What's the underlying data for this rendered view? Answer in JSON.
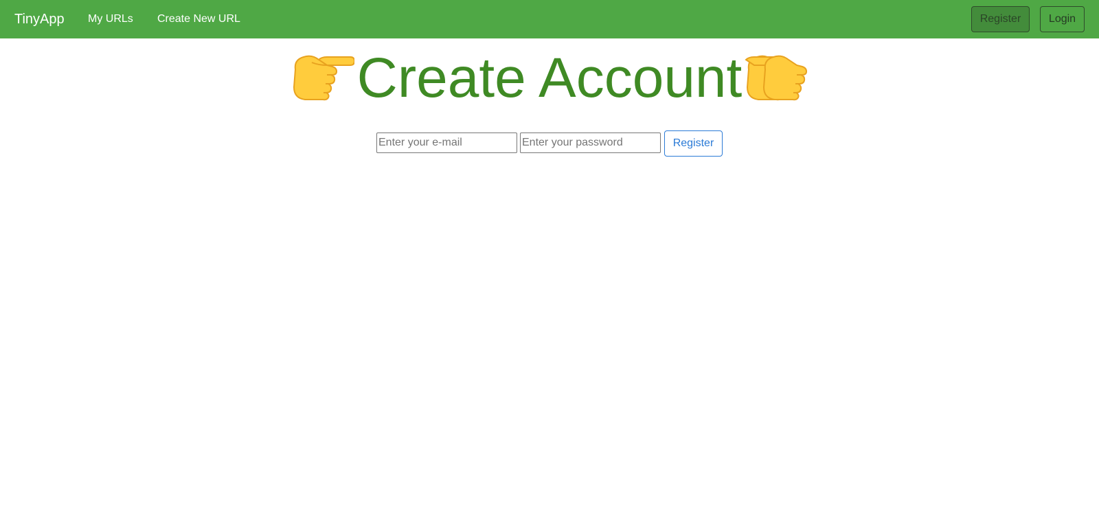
{
  "navbar": {
    "brand": "TinyApp",
    "links": [
      "My URLs",
      "Create New URL"
    ],
    "register_label": "Register",
    "login_label": "Login",
    "background_color": "#4fa845"
  },
  "main": {
    "title": "Create Account",
    "title_color": "#3f8a24",
    "left_icon": "pointing-right-hand-icon",
    "right_icon": "pointing-right-hand-icon",
    "form": {
      "email_placeholder": "Enter your e-mail",
      "email_value": "",
      "password_placeholder": "Enter your password",
      "password_value": "",
      "submit_label": "Register"
    }
  }
}
